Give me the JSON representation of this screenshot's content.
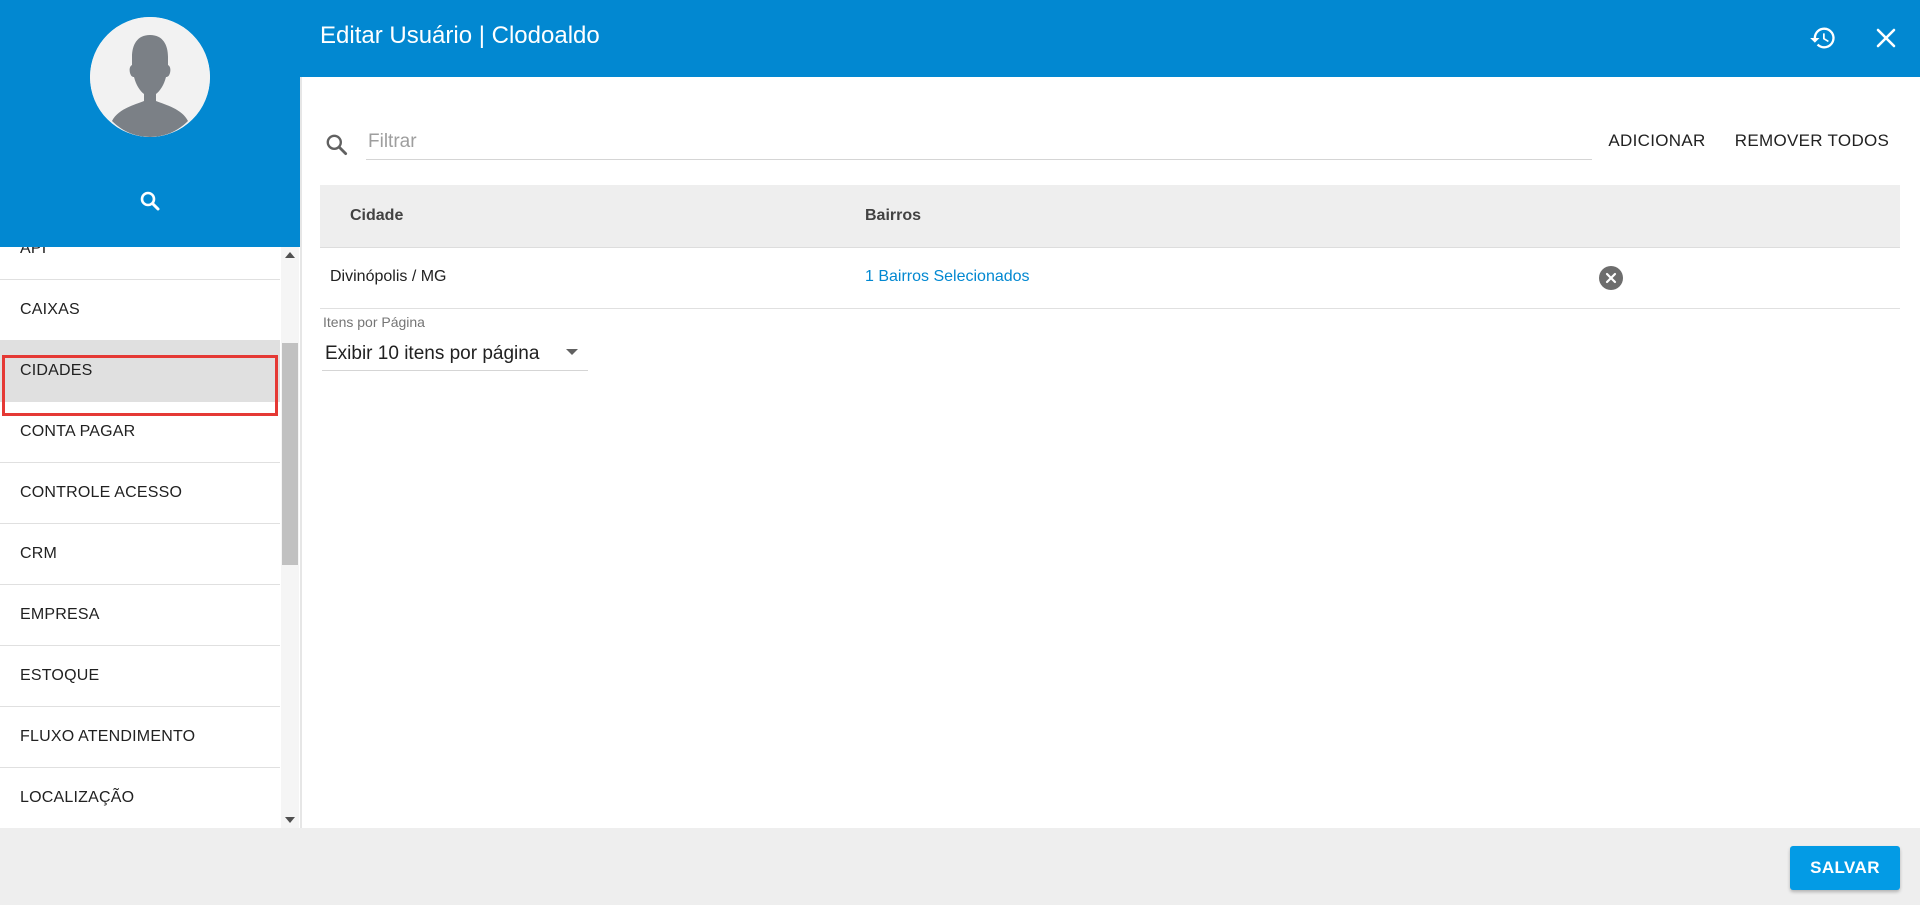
{
  "header": {
    "title": "Editar Usuário | Clodoaldo",
    "history_icon": "history-icon",
    "close_icon": "close-icon"
  },
  "sidebar": {
    "avatar_icon": "user-silhouette-icon",
    "search_icon": "search-icon",
    "items": [
      {
        "label": "API",
        "selected": false
      },
      {
        "label": "CAIXAS",
        "selected": false
      },
      {
        "label": "CIDADES",
        "selected": true
      },
      {
        "label": "CONTA PAGAR",
        "selected": false
      },
      {
        "label": "CONTROLE ACESSO",
        "selected": false
      },
      {
        "label": "CRM",
        "selected": false
      },
      {
        "label": "EMPRESA",
        "selected": false
      },
      {
        "label": "ESTOQUE",
        "selected": false
      },
      {
        "label": "FLUXO ATENDIMENTO",
        "selected": false
      },
      {
        "label": "LOCALIZAÇÃO",
        "selected": false
      }
    ]
  },
  "toolbar": {
    "filter_placeholder": "Filtrar",
    "filter_value": "",
    "add_label": "ADICIONAR",
    "remove_all_label": "REMOVER TODOS"
  },
  "table": {
    "columns": [
      "Cidade",
      "Bairros"
    ],
    "rows": [
      {
        "city": "Divinópolis / MG",
        "neighborhoods": "1 Bairros Selecionados"
      }
    ]
  },
  "pagination": {
    "label": "Itens por Página",
    "selected": "Exibir 10 itens por página"
  },
  "footer": {
    "save_label": "SALVAR"
  },
  "colors": {
    "primary": "#0288d1",
    "save_button": "#039be5",
    "highlight": "#e53935"
  }
}
